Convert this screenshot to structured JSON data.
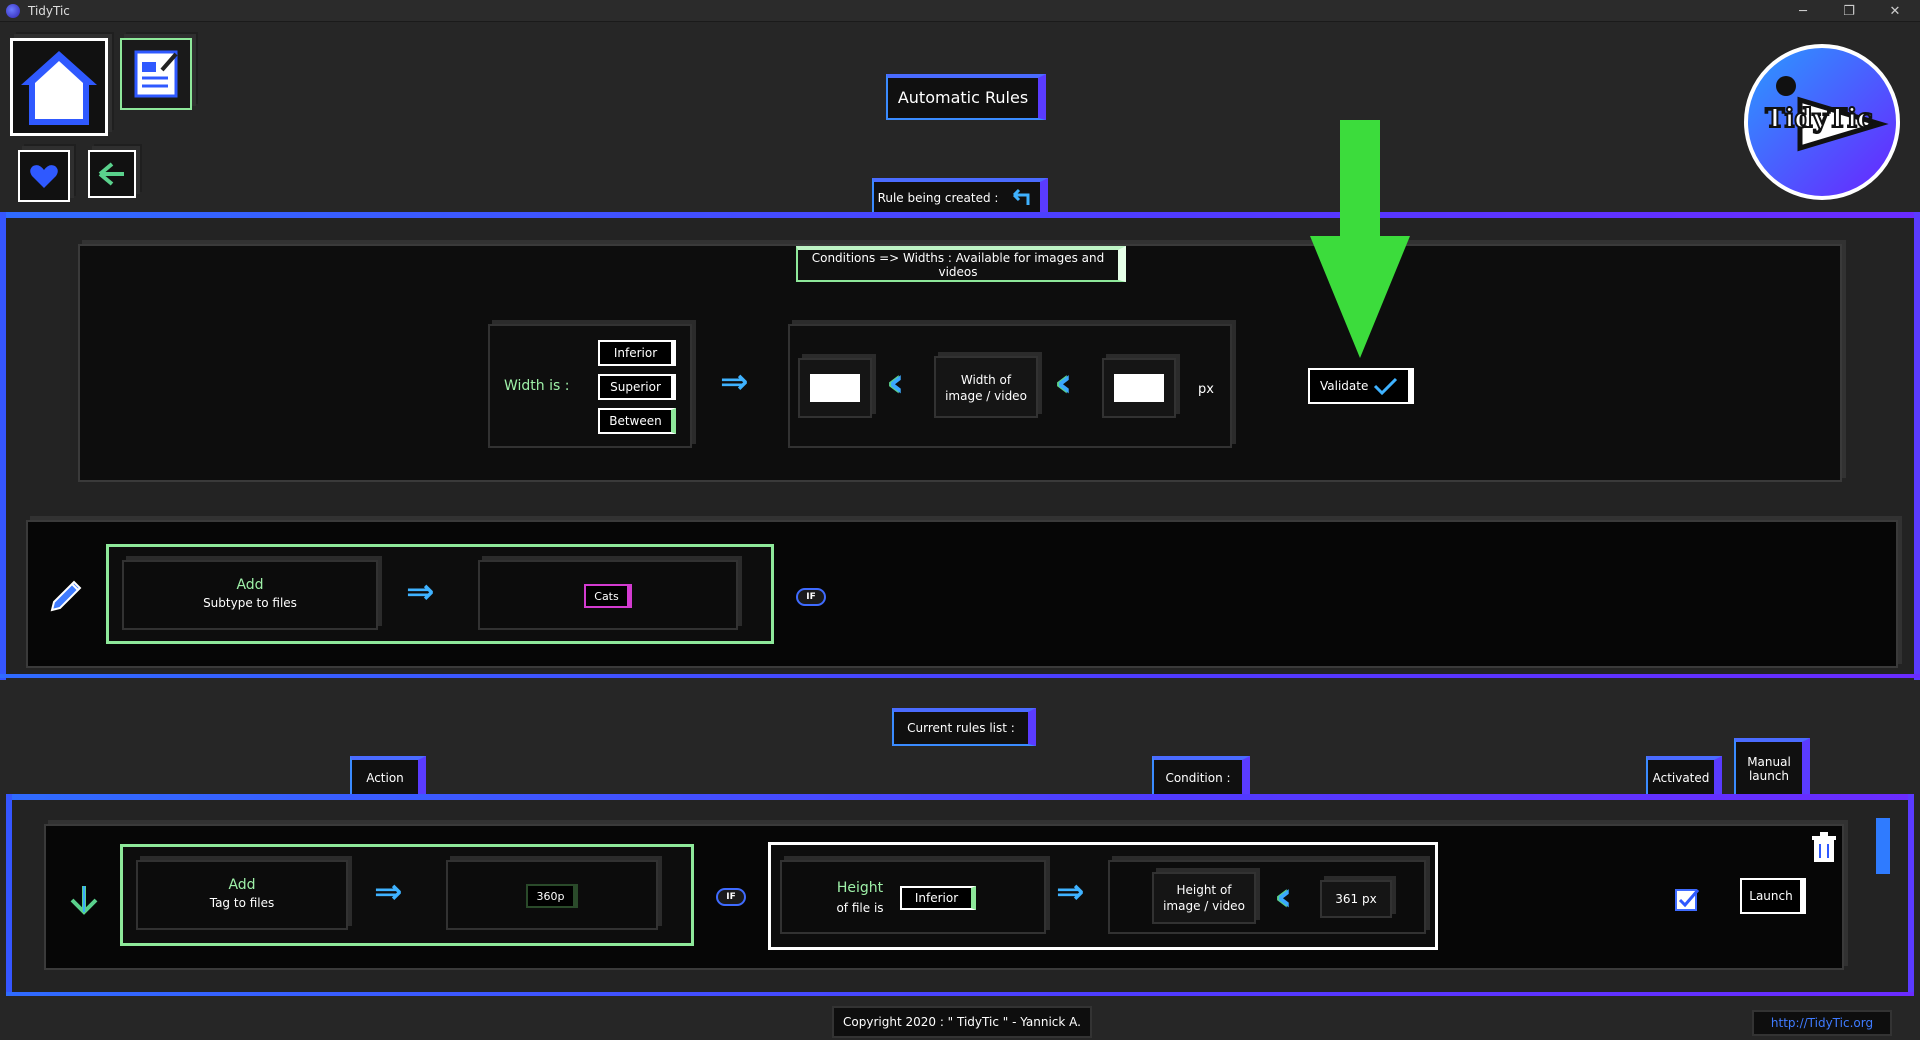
{
  "window": {
    "title": "TidyTic",
    "controls": {
      "minimize": "─",
      "restore": "❐",
      "close": "✕"
    }
  },
  "header": {
    "title": "Automatic Rules",
    "logo_text": "TidyTic"
  },
  "rule_being_created": {
    "tab_label": "Rule being created :",
    "conditions_title": "Conditions => Widths : Available for images and videos",
    "width_is_label": "Width is :",
    "options": [
      "Inferior",
      "Superior",
      "Between"
    ],
    "selected_option": "Between",
    "input_min": "",
    "input_max": "",
    "width_label_line1": "Width of",
    "width_label_line2": "image / video",
    "unit": "px",
    "validate_label": "Validate",
    "action": {
      "verb": "Add",
      "target": "Subtype to files",
      "value": "Cats"
    },
    "if_badge": "IF"
  },
  "current_rules": {
    "tab_label": "Current rules list :",
    "headers": {
      "action": "Action",
      "condition": "Condition :",
      "activated": "Activated",
      "manual_line1": "Manual",
      "manual_line2": "launch"
    },
    "rows": [
      {
        "action_verb": "Add",
        "action_target": "Tag to files",
        "action_value": "360p",
        "if_badge": "IF",
        "cond_line1": "Height",
        "cond_line2": "of file is",
        "cond_op": "Inferior",
        "cond_label_line1": "Height of",
        "cond_label_line2": "image / video",
        "cond_value": "361 px",
        "activated": true,
        "launch_label": "Launch"
      }
    ]
  },
  "footer": {
    "copyright": "Copyright 2020 : \" TidyTic \" - Yannick A.",
    "link": "http://TidyTic.org"
  },
  "colors": {
    "accent_blue": "#3a8bff",
    "accent_purple": "#5a3bff",
    "accent_green": "#8ee89a",
    "big_arrow": "#3cdc3c"
  }
}
